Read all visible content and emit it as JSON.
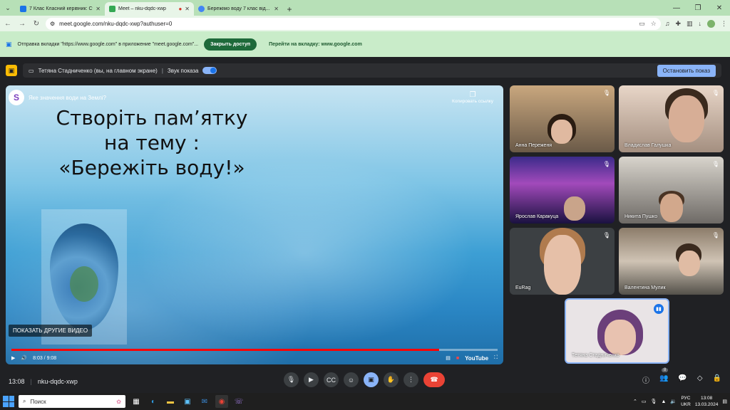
{
  "browser": {
    "tabs": [
      {
        "title": "7 Клас Класний керівник: Ста...",
        "active": false
      },
      {
        "title": "Meet – nku-dqdc-xwp",
        "active": true
      },
      {
        "title": "Бережімо воду 7 клас від...",
        "active": false
      }
    ],
    "url": "meet.google.com/nku-dqdc-xwp?authuser=0"
  },
  "infobar": {
    "text": "Отправка вкладки \"https://www.google.com\" в приложение \"meet.google.com\"...",
    "close_access": "Закрыть доступ",
    "goto_tab": "Перейти на вкладку: www.google.com"
  },
  "presenting": {
    "presenter": "Тетяна Стадниченко (вы, на главном экране)",
    "sound_label": "Звук показа",
    "stop_label": "Остановить показ"
  },
  "video": {
    "title": "Яке значення води на Землі?",
    "copy_link": "Копировать ссылку",
    "slide_text": "Створіть пам’ятку на тему : «Бережіть воду!»",
    "more_videos": "ПОКАЗАТЬ ДРУГИЕ ВИДЕО",
    "time": "8:03 / 9:08",
    "progress": 0.88,
    "brand": "YouTube"
  },
  "participants": [
    {
      "name": "Анна Переженя"
    },
    {
      "name": "Владислав Галушка"
    },
    {
      "name": "Ярослав Каракуца"
    },
    {
      "name": "Никита Пушко"
    },
    {
      "name": "EuRag"
    },
    {
      "name": "Валентина Мулик"
    },
    {
      "name": "Тетяна Стадниченко"
    }
  ],
  "meeting": {
    "time": "13:08",
    "code": "nku-dqdc-xwp",
    "participants_count": "8"
  },
  "taskbar": {
    "search_placeholder": "Поиск",
    "lang": "РУС",
    "lang2": "UKR",
    "time": "13:08",
    "date": "13.03.2024"
  }
}
